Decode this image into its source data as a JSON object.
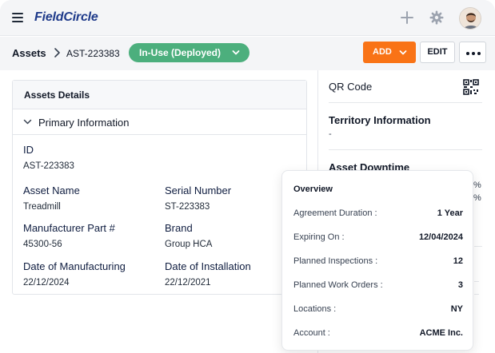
{
  "app": {
    "brand": "FieldCircle"
  },
  "topbar": {
    "menu_icon": "hamburger-icon",
    "add_icon": "plus-icon",
    "settings_icon": "gear-icon",
    "avatar_icon": "avatar"
  },
  "breadcrumb": {
    "root": "Assets",
    "current": "AST-223383"
  },
  "status": {
    "label": "In-Use (Deployed)",
    "color": "#4caf7d"
  },
  "actions": {
    "add_label": "ADD",
    "edit_label": "EDIT",
    "add_color": "#f97316"
  },
  "details": {
    "title": "Assets Details",
    "section": "Primary Information",
    "fields": {
      "id": {
        "label": "ID",
        "value": "AST-223383"
      },
      "asset_name": {
        "label": "Asset Name",
        "value": "Treadmill"
      },
      "serial_number": {
        "label": "Serial Number",
        "value": "ST-223383"
      },
      "mfr_part": {
        "label": "Manufacturer Part #",
        "value": "45300-56"
      },
      "brand": {
        "label": "Brand",
        "value": "Group HCA"
      },
      "date_mfg": {
        "label": "Date of Manufacturing",
        "value": "22/12/2024"
      },
      "date_install": {
        "label": "Date of Installation",
        "value": "22/12/2021"
      }
    }
  },
  "sidebar": {
    "qr_label": "QR Code",
    "territory_label": "Territory Information",
    "territory_value": "-",
    "downtime_label": "Asset Downtime",
    "peek_1": "%",
    "peek_2": "%"
  },
  "overview": {
    "title": "Overview",
    "rows": [
      {
        "label": "Agreement Duration :",
        "value": "1 Year"
      },
      {
        "label": "Expiring On :",
        "value": "12/04/2024"
      },
      {
        "label": "Planned Inspections :",
        "value": "12"
      },
      {
        "label": "Planned Work Orders :",
        "value": "3"
      },
      {
        "label": "Locations :",
        "value": "NY"
      },
      {
        "label": "Account :",
        "value": "ACME Inc."
      }
    ]
  }
}
